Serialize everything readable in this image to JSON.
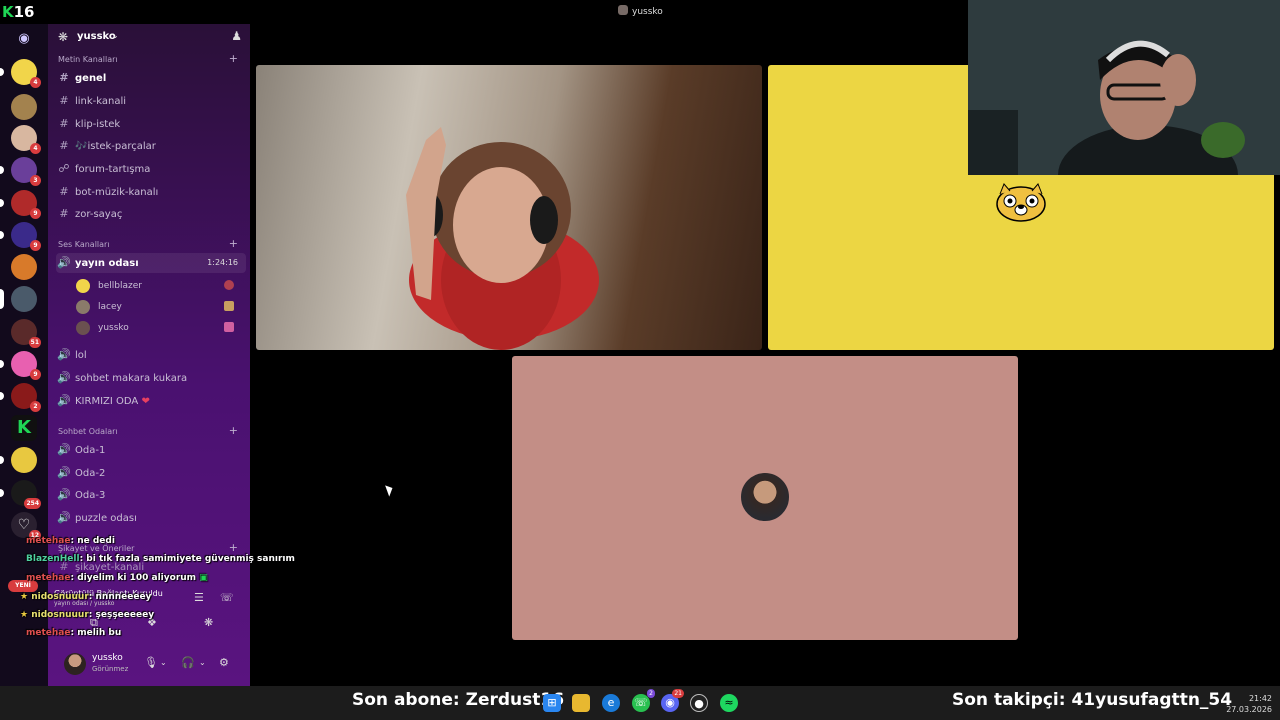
{
  "overlay": {
    "logo_letter": "K",
    "logo_number": "16",
    "bottom_left": "Son abone: Zerdust16",
    "bottom_right": "Son takipçi: 41yusufagttn_54"
  },
  "window_title": "yussko",
  "server": {
    "name": "yussko",
    "categories": {
      "text": "Metin Kanalları",
      "voice": "Ses Kanalları",
      "chat_rooms": "Sohbet Odaları",
      "complaints": "Şikayet ve Öneriler"
    },
    "text_channels": [
      "genel",
      "link-kanali",
      "klip-istek",
      "🎶istek-parçalar",
      "forum-tartışma",
      "bot-müzik-kanalı",
      "zor-sayaç"
    ],
    "voice_active": {
      "name": "yayın odası",
      "timer": "1:24:16"
    },
    "voice_members": [
      "bellblazer",
      "lacey",
      "yussko"
    ],
    "voice_channels": [
      "lol",
      "sohbet makara kukara",
      "KIRMIZI ODA"
    ],
    "chat_room_channels": [
      "Oda-1",
      "Oda-2",
      "Oda-3",
      "puzzle odası"
    ],
    "complaint_channels": [
      "şikayet-kanali"
    ]
  },
  "server_rail": {
    "badges": [
      "4",
      "4",
      "3",
      "9",
      "9",
      "51",
      "9",
      "2",
      "254",
      "12"
    ],
    "new_label": "YENİ"
  },
  "voice_connection": {
    "title": "Görüntülü Bağlantı Kuruldu",
    "subtitle": "yayın odası / yussko"
  },
  "user": {
    "name": "yussko",
    "status": "Görünmez"
  },
  "chat": [
    {
      "user": "metehae",
      "msg": ": ne dedi"
    },
    {
      "user": "BlazenHell",
      "msg": ": bi tık fazla samimiyete güvenmiş sanırım"
    },
    {
      "user": "metehae",
      "msg": ": diyelim ki 100 aliyorum"
    },
    {
      "user": "nidosnuuur",
      "msg": ": nnnneeeey"
    },
    {
      "user": "nidosnuuur",
      "msg": ": şeşşeeeeey"
    },
    {
      "user": "metehae",
      "msg": ": melih bu"
    }
  ],
  "taskbar": {
    "icons": [
      "windows-start",
      "file-explorer",
      "edge-browser",
      "whatsapp",
      "discord",
      "obs-studio",
      "spotify"
    ],
    "whatsapp_badge": "2",
    "discord_badge": "21",
    "time": "21:42",
    "date": "27.03.2026"
  },
  "colors": {
    "sidebar_top": "#2a1038",
    "sidebar_bottom": "#5a1480",
    "tile_yellow": "#ecd643",
    "tile_pink": "#c38e86",
    "badge_red": "#d83c3e"
  }
}
